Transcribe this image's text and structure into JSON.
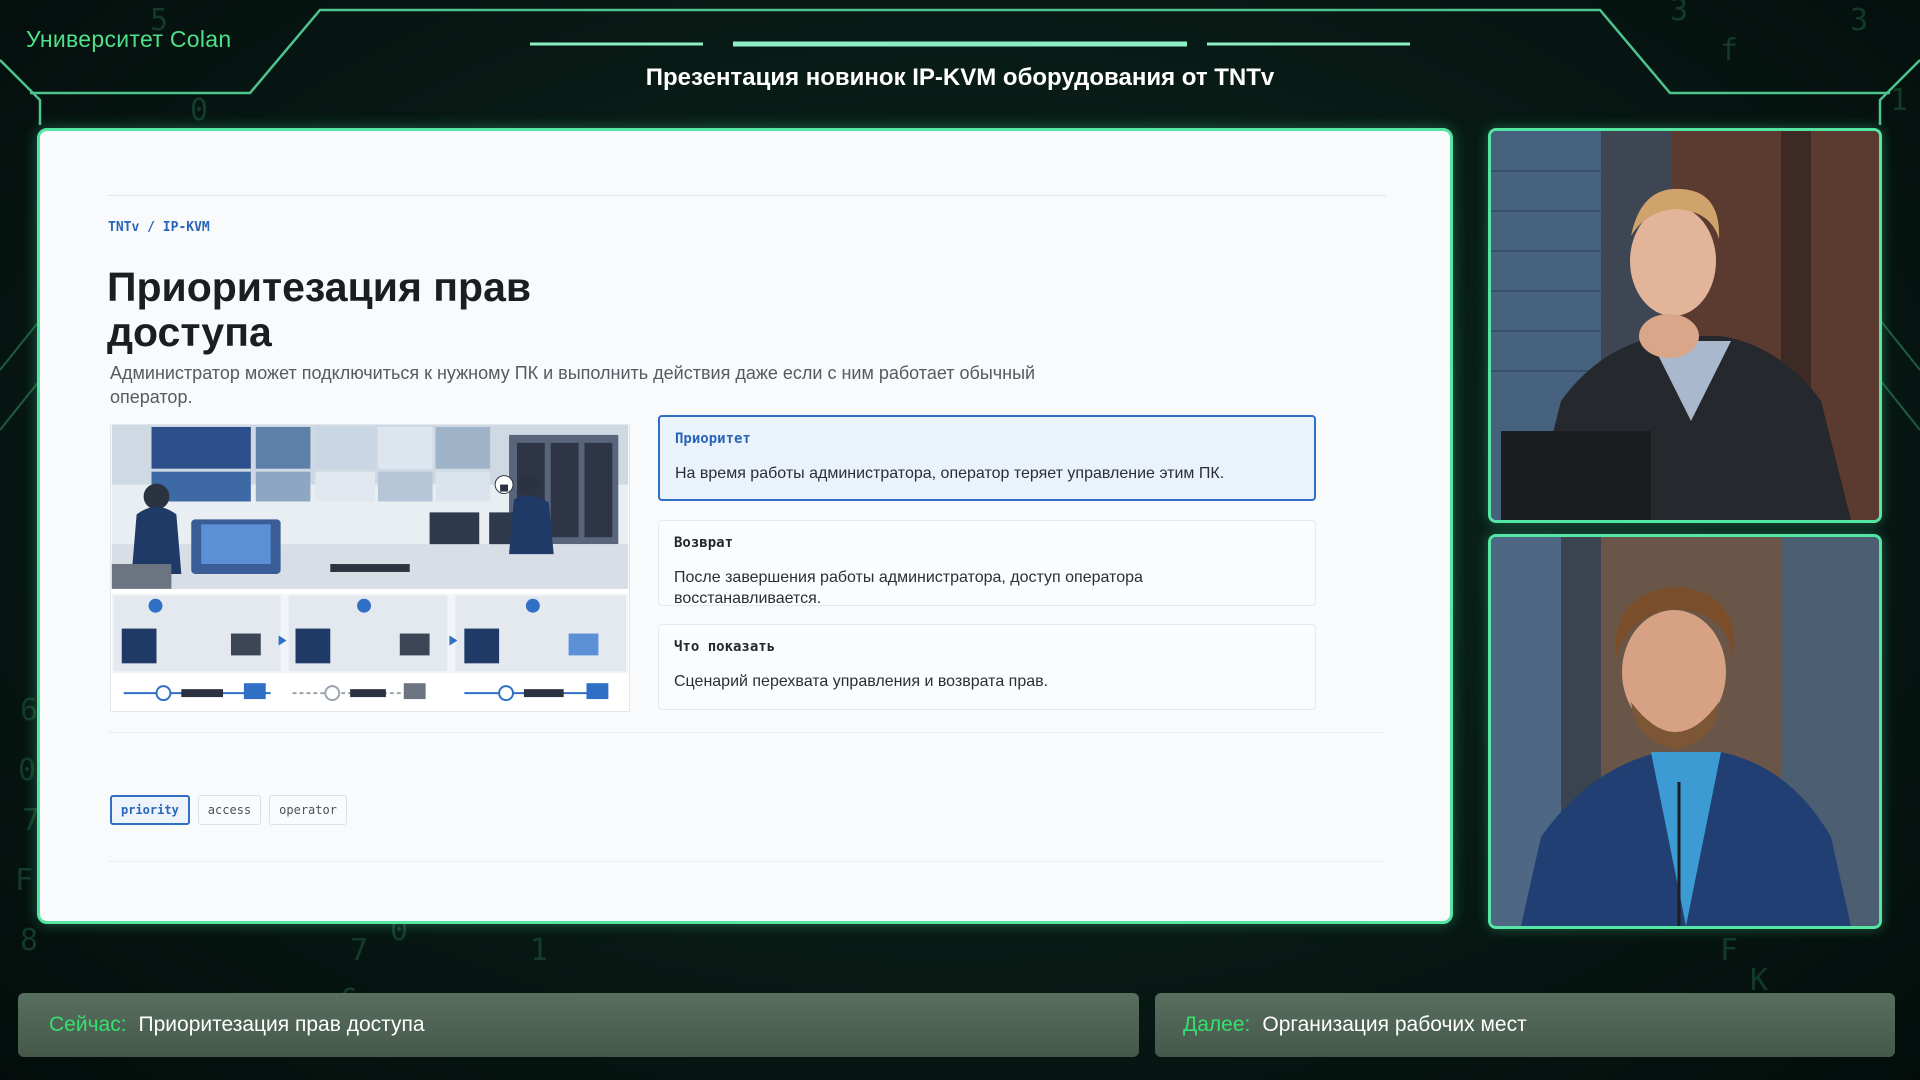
{
  "header": {
    "brand": "Университет Colan",
    "title": "Презентация новинок IP-KVM оборудования от TNTv"
  },
  "slide": {
    "breadcrumb": "TNTv / IP-KVM",
    "heading": "Приоритезация прав доступа",
    "lead": "Администратор может подключиться к нужному ПК и выполнить действия даже если с ним работает обычный оператор.",
    "cards": [
      {
        "title": "Приоритет",
        "body": "На время работы администратора, оператор теряет управление этим ПК.",
        "active": true
      },
      {
        "title": "Возврат",
        "body": "После завершения работы администратора, доступ оператора восстанавливается.",
        "active": false
      },
      {
        "title": "Что показать",
        "body": "Сценарий перехвата управления и возврата прав.",
        "active": false
      }
    ],
    "tags": [
      {
        "label": "priority",
        "active": true
      },
      {
        "label": "access",
        "active": false
      },
      {
        "label": "operator",
        "active": false
      }
    ]
  },
  "ticker": {
    "now_label": "Сейчас:",
    "now_text": "Приоритезация прав доступа",
    "next_label": "Далее:",
    "next_text": "Организация рабочих мест"
  },
  "colors": {
    "accent_green": "#55e6a4",
    "label_green": "#36e06e",
    "link_blue": "#2a66b8"
  }
}
